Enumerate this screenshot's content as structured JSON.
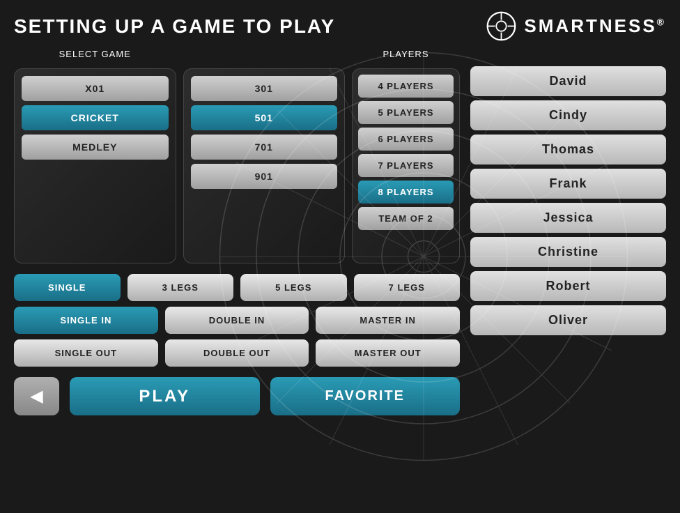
{
  "header": {
    "title": "SETTING UP A GAME TO PLAY",
    "logo_text": "SMARTNESS",
    "logo_reg": "®"
  },
  "select_game": {
    "label": "SELECT GAME",
    "game_types": [
      {
        "id": "x01",
        "label": "X01",
        "active": false
      },
      {
        "id": "cricket",
        "label": "CRICKET",
        "active": true
      },
      {
        "id": "medley",
        "label": "MEDLEY",
        "active": false
      }
    ],
    "variants": [
      {
        "id": "301",
        "label": "301",
        "active": false
      },
      {
        "id": "501",
        "label": "501",
        "active": true
      },
      {
        "id": "701",
        "label": "701",
        "active": false
      },
      {
        "id": "901",
        "label": "901",
        "active": false
      }
    ]
  },
  "players": {
    "label": "PLAYERS",
    "options": [
      {
        "id": "4p",
        "label": "4 PLAYERS",
        "active": false
      },
      {
        "id": "5p",
        "label": "5 PLAYERS",
        "active": false
      },
      {
        "id": "6p",
        "label": "6 PLAYERS",
        "active": false
      },
      {
        "id": "7p",
        "label": "7 PLAYERS",
        "active": false
      },
      {
        "id": "8p",
        "label": "8 PLAYERS",
        "active": true
      },
      {
        "id": "team2",
        "label": "TEAM OF 2",
        "active": false
      }
    ]
  },
  "legs": {
    "options": [
      {
        "id": "single",
        "label": "SINGLE",
        "active": true
      },
      {
        "id": "3legs",
        "label": "3 LEGS",
        "active": false
      },
      {
        "id": "5legs",
        "label": "5 LEGS",
        "active": false
      },
      {
        "id": "7legs",
        "label": "7 LEGS",
        "active": false
      }
    ]
  },
  "in_options": {
    "options": [
      {
        "id": "single_in",
        "label": "SINGLE IN",
        "active": true
      },
      {
        "id": "double_in",
        "label": "DOUBLE IN",
        "active": false
      },
      {
        "id": "master_in",
        "label": "MASTER IN",
        "active": false
      }
    ]
  },
  "out_options": {
    "options": [
      {
        "id": "single_out",
        "label": "SINGLE OUT",
        "active": false
      },
      {
        "id": "double_out",
        "label": "DOUBLE OUT",
        "active": false
      },
      {
        "id": "master_out",
        "label": "MASTER OUT",
        "active": false
      }
    ]
  },
  "actions": {
    "back_arrow": "◀",
    "play_label": "PLAY",
    "favorite_label": "FAVORITE"
  },
  "player_list": [
    {
      "id": "david",
      "name": "David"
    },
    {
      "id": "cindy",
      "name": "Cindy"
    },
    {
      "id": "thomas",
      "name": "Thomas"
    },
    {
      "id": "frank",
      "name": "Frank"
    },
    {
      "id": "jessica",
      "name": "Jessica"
    },
    {
      "id": "christine",
      "name": "Christine"
    },
    {
      "id": "robert",
      "name": "Robert"
    },
    {
      "id": "oliver",
      "name": "Oliver"
    }
  ]
}
